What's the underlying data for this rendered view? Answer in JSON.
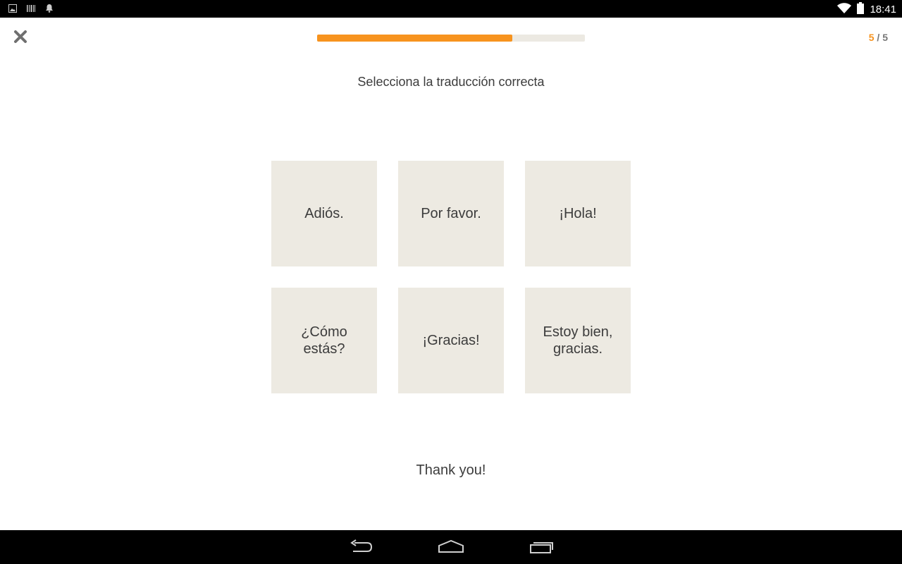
{
  "status_bar": {
    "time": "18:41",
    "left_icons": [
      "image-icon",
      "barcode-icon",
      "bell-icon"
    ],
    "right_icons": [
      "wifi-icon",
      "battery-icon"
    ]
  },
  "header": {
    "close_icon": "close-icon",
    "progress_fraction": 0.73,
    "counter_current": "5",
    "counter_separator": " / ",
    "counter_total": "5"
  },
  "exercise": {
    "instruction": "Selecciona la traducción correcta",
    "options": [
      "Adiós.",
      "Por favor.",
      "¡Hola!",
      "¿Cómo estás?",
      "¡Gracias!",
      "Estoy bien, gracias."
    ],
    "prompt": "Thank you!"
  },
  "nav_bar": {
    "icons": [
      "back-icon",
      "home-icon",
      "recents-icon"
    ]
  },
  "colors": {
    "accent": "#f7931e",
    "tile": "#edeae2",
    "track": "#ece9e2",
    "text": "#3c3c3c"
  }
}
